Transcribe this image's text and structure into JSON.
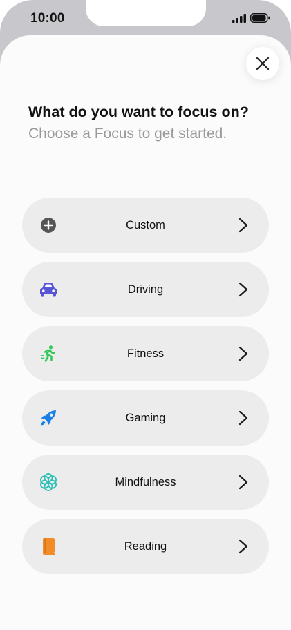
{
  "status_bar": {
    "time": "10:00"
  },
  "header": {
    "title": "What do you want to focus on?",
    "subtitle": "Choose a Focus to get started."
  },
  "focus_options": [
    {
      "label": "Custom",
      "icon": "plus-circle-icon",
      "color": "#555555"
    },
    {
      "label": "Driving",
      "icon": "car-icon",
      "color": "#5856d6"
    },
    {
      "label": "Fitness",
      "icon": "running-icon",
      "color": "#34c759"
    },
    {
      "label": "Gaming",
      "icon": "rocket-icon",
      "color": "#1a7fe6"
    },
    {
      "label": "Mindfulness",
      "icon": "flower-icon",
      "color": "#30c0b5"
    },
    {
      "label": "Reading",
      "icon": "book-icon",
      "color": "#f28c28"
    }
  ]
}
